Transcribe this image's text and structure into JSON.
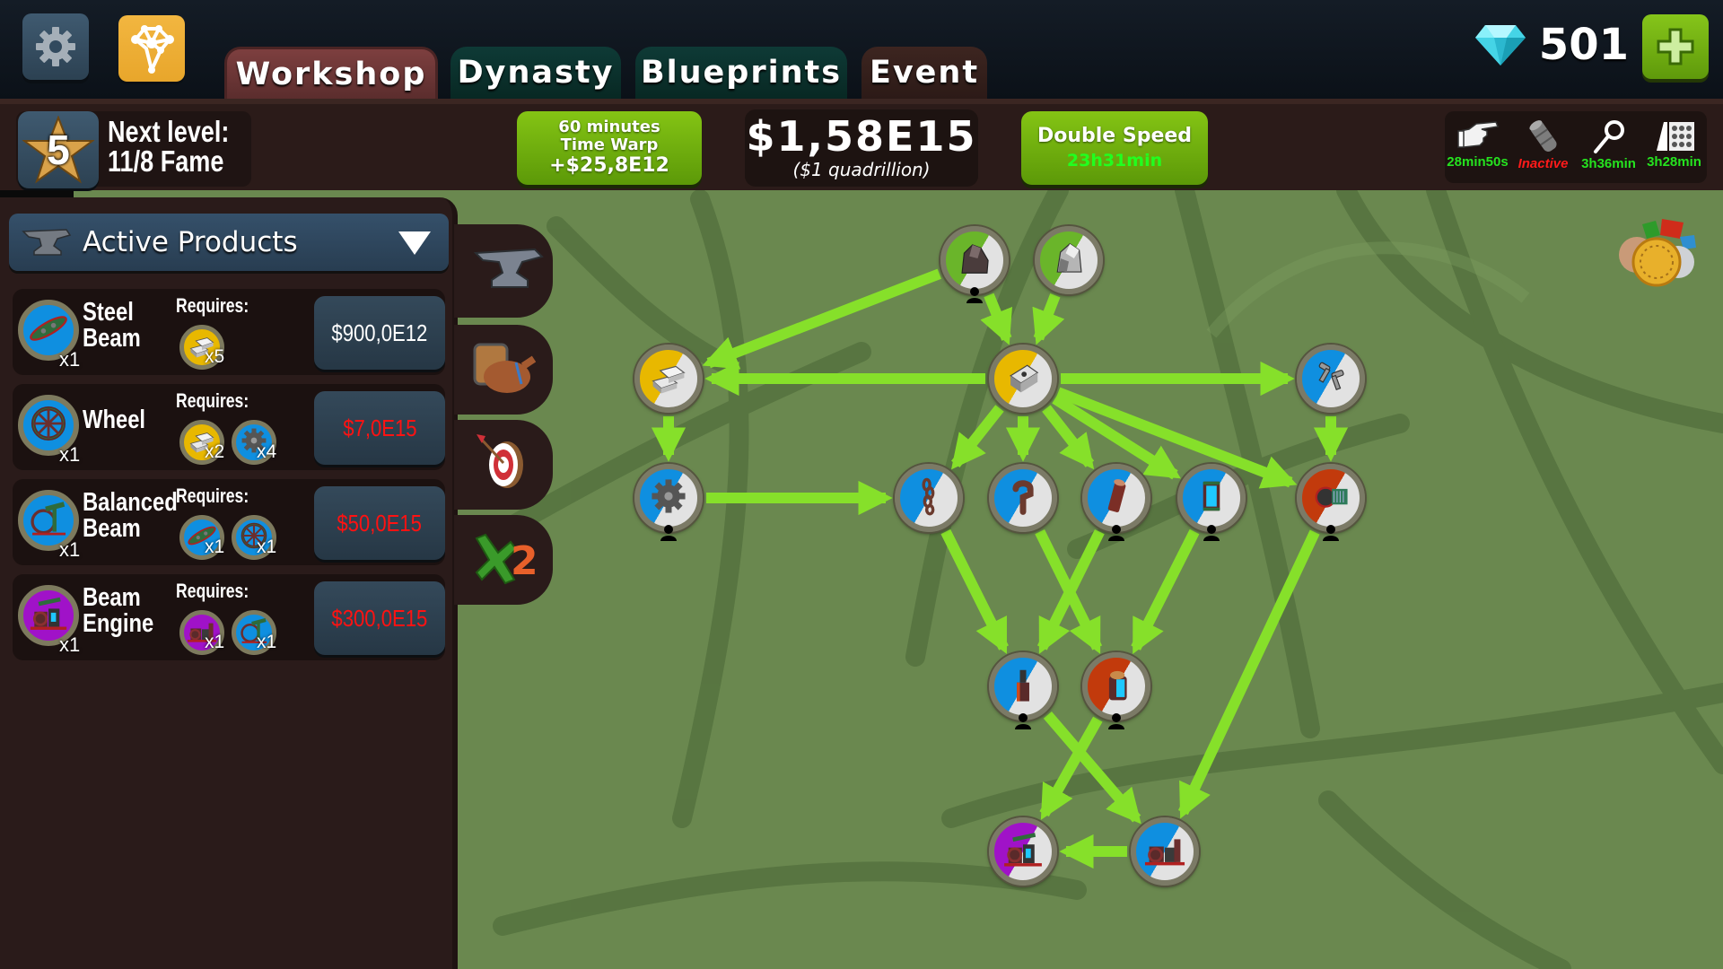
{
  "header": {
    "icons": {
      "settings": "gear-icon",
      "network": "research-network-icon"
    },
    "tabs": [
      {
        "label": "Workshop",
        "active": true
      },
      {
        "label": "Dynasty",
        "active": false
      },
      {
        "label": "Blueprints",
        "active": false
      },
      {
        "label": "Event",
        "active": false
      }
    ],
    "gems": {
      "icon": "diamond-icon",
      "count": "501",
      "add_icon": "plus-icon"
    }
  },
  "status_bar": {
    "level": {
      "number": "5",
      "line1": "Next level:",
      "line2": "11/8 Fame"
    },
    "time_warp": {
      "line1": "60 minutes",
      "line2": "Time Warp",
      "line3": "+$25,8E12"
    },
    "money": {
      "amount": "$1,58E15",
      "words": "($1 quadrillion)"
    },
    "double_speed": {
      "label": "Double Speed",
      "timer": "23h31min"
    },
    "boosts": [
      {
        "icon": "pointing-hand-icon",
        "label": "28min50s",
        "state": "active"
      },
      {
        "icon": "scroll-icon",
        "label": "Inactive",
        "state": "inactive"
      },
      {
        "icon": "magnifier-icon",
        "label": "3h36min",
        "state": "active"
      },
      {
        "icon": "abacus-icon",
        "label": "3h28min",
        "state": "active"
      }
    ]
  },
  "panel": {
    "title": "Active Products",
    "title_icon": "anvil-icon",
    "requires_label": "Requires:",
    "products": [
      {
        "name_line1": "Steel",
        "name_line2": "Beam",
        "qty": "x1",
        "color": "#0f8fe0",
        "icon": "steel-beam-icon",
        "requires": [
          {
            "icon": "silver-bars-icon",
            "qty": "x5",
            "color": "#e8b800"
          }
        ],
        "price": "$900,0E12",
        "affordable": true
      },
      {
        "name_line1": "Wheel",
        "name_line2": "",
        "qty": "x1",
        "color": "#0f8fe0",
        "icon": "wheel-icon",
        "requires": [
          {
            "icon": "silver-bars-icon",
            "qty": "x2",
            "color": "#e8b800"
          },
          {
            "icon": "gear-part-icon",
            "qty": "x4",
            "color": "#0f8fe0"
          }
        ],
        "price": "$7,0E15",
        "affordable": false
      },
      {
        "name_line1": "Balanced",
        "name_line2": "Beam",
        "qty": "x1",
        "color": "#0f8fe0",
        "icon": "balanced-beam-icon",
        "requires": [
          {
            "icon": "steel-beam-icon",
            "qty": "x1",
            "color": "#0f8fe0"
          },
          {
            "icon": "wheel-icon",
            "qty": "x1",
            "color": "#0f8fe0"
          }
        ],
        "price": "$50,0E15",
        "affordable": false
      },
      {
        "name_line1": "Beam",
        "name_line2": "Engine",
        "qty": "x1",
        "color": "#a012c8",
        "icon": "beam-engine-icon",
        "requires": [
          {
            "icon": "engine-icon",
            "qty": "x1",
            "color": "#a012c8"
          },
          {
            "icon": "balanced-beam-icon",
            "qty": "x1",
            "color": "#0f8fe0"
          }
        ],
        "price": "$300,0E15",
        "affordable": false
      }
    ]
  },
  "side_tabs": [
    {
      "icon": "anvil-icon"
    },
    {
      "icon": "barrel-bag-icon"
    },
    {
      "icon": "target-icon"
    },
    {
      "icon": "multiplier-x2-icon"
    }
  ],
  "medals_icon": "medals-icon",
  "graph": {
    "nodes": [
      {
        "id": "coal",
        "icon": "coal-icon",
        "color": "#6ab52a",
        "worker": true
      },
      {
        "id": "iron_ore",
        "icon": "iron-ore-icon",
        "color": "#6ab52a",
        "worker": false
      },
      {
        "id": "silver_bars",
        "icon": "silver-bars-icon",
        "color": "#e8b800",
        "worker": false
      },
      {
        "id": "steel_ingot",
        "icon": "steel-ingot-icon",
        "color": "#e8b800",
        "worker": false
      },
      {
        "id": "screws",
        "icon": "screws-icon",
        "color": "#0f8fe0",
        "worker": false
      },
      {
        "id": "gear",
        "icon": "gear-part-icon",
        "color": "#0f8fe0",
        "worker": true
      },
      {
        "id": "chain",
        "icon": "chain-icon",
        "color": "#0f8fe0",
        "worker": false
      },
      {
        "id": "pipe_hook",
        "icon": "pipe-hook-icon",
        "color": "#0f8fe0",
        "worker": false
      },
      {
        "id": "pipe",
        "icon": "pipe-icon",
        "color": "#0f8fe0",
        "worker": true
      },
      {
        "id": "battery",
        "icon": "battery-icon",
        "color": "#0f8fe0",
        "worker": true
      },
      {
        "id": "motor",
        "icon": "motor-icon",
        "color": "#c23a0c",
        "worker": true
      },
      {
        "id": "tank",
        "icon": "tank-icon",
        "color": "#0f8fe0",
        "worker": true
      },
      {
        "id": "boiler",
        "icon": "boiler-icon",
        "color": "#c23a0c",
        "worker": true
      },
      {
        "id": "beam_engine",
        "icon": "beam-engine-icon",
        "color": "#a012c8",
        "worker": false
      },
      {
        "id": "engine",
        "icon": "engine-icon",
        "color": "#0f8fe0",
        "worker": false
      }
    ],
    "edges": [
      [
        "coal",
        "silver_bars"
      ],
      [
        "coal",
        "steel_ingot"
      ],
      [
        "iron_ore",
        "steel_ingot"
      ],
      [
        "steel_ingot",
        "silver_bars"
      ],
      [
        "steel_ingot",
        "screws"
      ],
      [
        "silver_bars",
        "gear"
      ],
      [
        "gear",
        "chain"
      ],
      [
        "steel_ingot",
        "chain"
      ],
      [
        "steel_ingot",
        "pipe_hook"
      ],
      [
        "steel_ingot",
        "pipe"
      ],
      [
        "steel_ingot",
        "battery"
      ],
      [
        "steel_ingot",
        "motor"
      ],
      [
        "screws",
        "motor"
      ],
      [
        "chain",
        "tank"
      ],
      [
        "pipe",
        "tank"
      ],
      [
        "pipe_hook",
        "boiler"
      ],
      [
        "battery",
        "boiler"
      ],
      [
        "tank",
        "engine"
      ],
      [
        "boiler",
        "beam_engine"
      ],
      [
        "motor",
        "engine"
      ],
      [
        "engine",
        "beam_engine"
      ]
    ]
  }
}
